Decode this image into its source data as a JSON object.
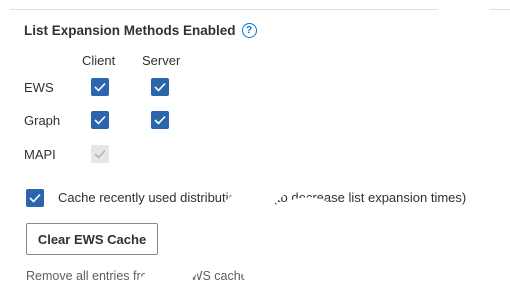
{
  "section": {
    "title": "List Expansion Methods Enabled",
    "help_icon": "help-circle-icon"
  },
  "columns": {
    "client": "Client",
    "server": "Server"
  },
  "rows": [
    {
      "label": "EWS",
      "client": "checked",
      "server": "checked"
    },
    {
      "label": "Graph",
      "client": "checked",
      "server": "checked"
    },
    {
      "label": "MAPI",
      "client": "checked-disabled",
      "server": "none"
    }
  ],
  "cache_option": {
    "label": "Cache recently used distribution lists (to decrease list expansion times)",
    "checked": true
  },
  "clear_button": {
    "label": "Clear EWS Cache"
  },
  "helper_text": "Remove all entries from the EWS cache.",
  "colors": {
    "checkbox_checked": "#2b66ad",
    "checkbox_disabled": "#e6e6e6",
    "help_icon": "#0078d4",
    "watermark": "#0e3a7a"
  },
  "watermark": {
    "icon": "diagonal-watermark-shape"
  }
}
